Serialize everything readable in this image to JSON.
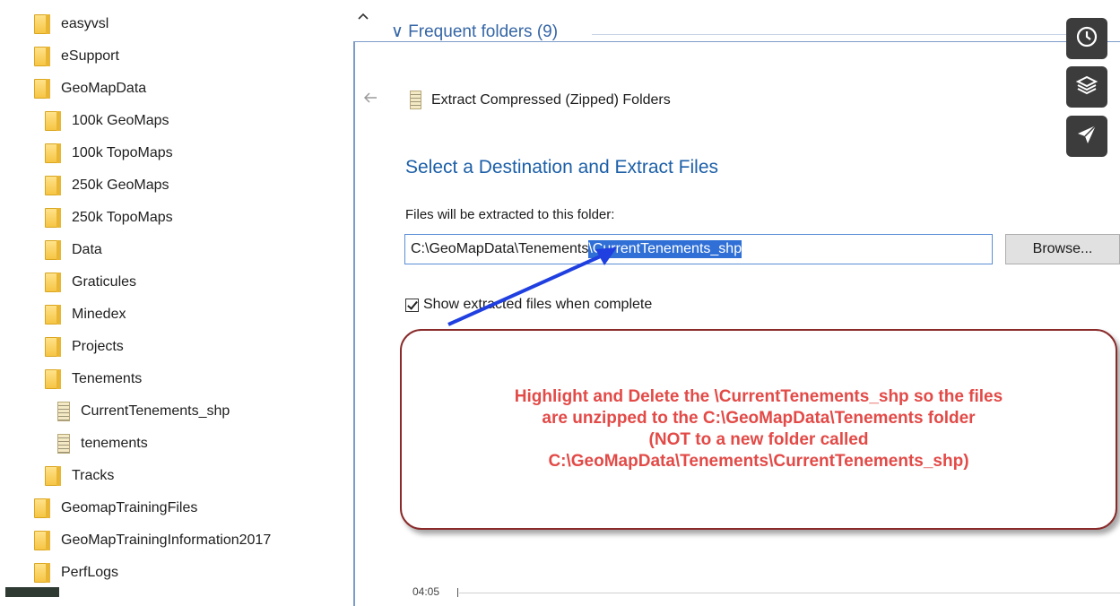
{
  "tree": {
    "items": [
      {
        "label": "easyvsl",
        "icon": "folder-icon"
      },
      {
        "label": "eSupport",
        "icon": "folder-icon"
      },
      {
        "label": "GeoMapData",
        "icon": "folder-icon"
      },
      {
        "label": "100k GeoMaps",
        "icon": "folder-icon"
      },
      {
        "label": "100k TopoMaps",
        "icon": "folder-icon"
      },
      {
        "label": "250k GeoMaps",
        "icon": "folder-icon"
      },
      {
        "label": "250k TopoMaps",
        "icon": "folder-icon"
      },
      {
        "label": "Data",
        "icon": "folder-icon"
      },
      {
        "label": "Graticules",
        "icon": "folder-icon"
      },
      {
        "label": "Minedex",
        "icon": "folder-icon"
      },
      {
        "label": "Projects",
        "icon": "folder-icon"
      },
      {
        "label": "Tenements",
        "icon": "folder-icon"
      },
      {
        "label": "CurrentTenements_shp",
        "icon": "zip-icon"
      },
      {
        "label": "tenements",
        "icon": "zip-icon"
      },
      {
        "label": "Tracks",
        "icon": "folder-icon"
      },
      {
        "label": "GeomapTrainingFiles",
        "icon": "folder-icon"
      },
      {
        "label": "GeoMapTrainingInformation2017",
        "icon": "folder-icon"
      },
      {
        "label": "PerfLogs",
        "icon": "folder-icon"
      }
    ]
  },
  "explorer": {
    "scroll_up_icon": "chevron-up-icon",
    "frequent_folders": "∨ Frequent folders (9)"
  },
  "dialog": {
    "back_icon": "back-arrow-icon",
    "title": "Extract Compressed (Zipped) Folders",
    "heading": "Select a Destination and Extract Files",
    "dest_label": "Files will be extracted to this folder:",
    "path_prefix": "C:\\GeoMapData\\Tenements",
    "path_selected": "\\CurrentTenements_shp",
    "browse_label": "Browse...",
    "show_files_label": "Show extracted files when complete",
    "show_files_checked": true
  },
  "annotation": {
    "lines": [
      "Highlight and Delete the \\CurrentTenements_shp so the files",
      "are unzipped to the C:\\GeoMapData\\Tenements folder",
      "(NOT to a new folder called",
      "C:\\GeoMapData\\Tenements\\CurrentTenements_shp)"
    ],
    "text_color": "#e24a47",
    "border_color": "#8a2a2a",
    "arrow_color": "#1f3fe0"
  },
  "toolbar": {
    "buttons": [
      "clock-icon",
      "layers-icon",
      "send-icon"
    ]
  },
  "footer": {
    "time": "04:05"
  }
}
